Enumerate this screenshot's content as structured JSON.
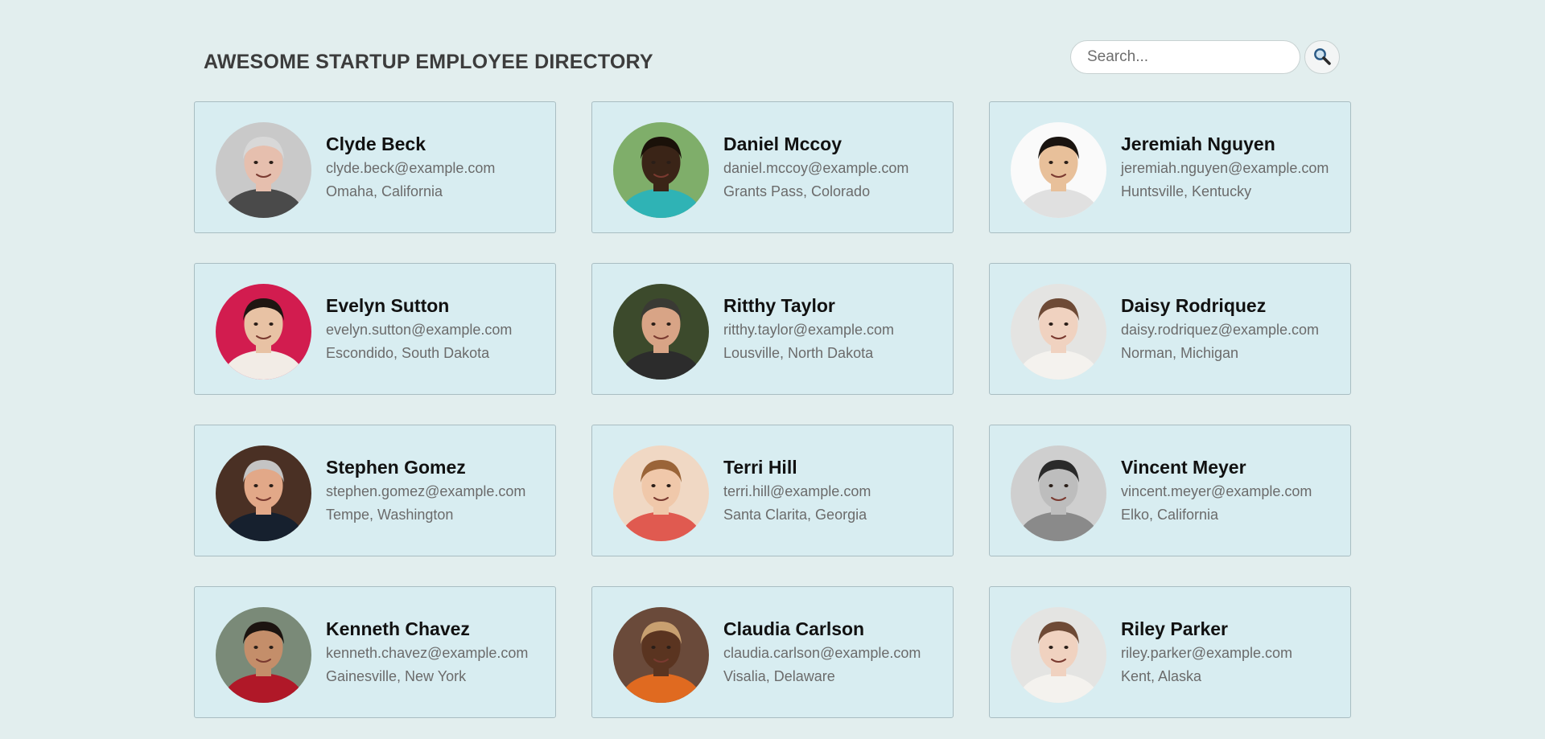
{
  "header": {
    "title": "AWESOME STARTUP EMPLOYEE DIRECTORY",
    "search_placeholder": "Search...",
    "search_value": ""
  },
  "employees": [
    {
      "name": "Clyde Beck",
      "email": "clyde.beck@example.com",
      "location": "Omaha, California",
      "avatar": {
        "bg": "#c9c9c9",
        "skin": "#e6bfae",
        "hair": "#d8d8d8",
        "shirt": "#4a4a4a"
      }
    },
    {
      "name": "Daniel Mccoy",
      "email": "daniel.mccoy@example.com",
      "location": "Grants Pass, Colorado",
      "avatar": {
        "bg": "#7fae6a",
        "skin": "#3a2417",
        "hair": "#1a1109",
        "shirt": "#2fb3b5"
      }
    },
    {
      "name": "Jeremiah Nguyen",
      "email": "jeremiah.nguyen@example.com",
      "location": "Huntsville, Kentucky",
      "avatar": {
        "bg": "#fafafa",
        "skin": "#e8c09a",
        "hair": "#1a1410",
        "shirt": "#e0e0e0"
      }
    },
    {
      "name": "Evelyn Sutton",
      "email": "evelyn.sutton@example.com",
      "location": "Escondido, South Dakota",
      "avatar": {
        "bg": "#d21c4f",
        "skin": "#e8c2a4",
        "hair": "#1f1612",
        "shirt": "#f2ece6"
      }
    },
    {
      "name": "Ritthy Taylor",
      "email": "ritthy.taylor@example.com",
      "location": "Lousville, North Dakota",
      "avatar": {
        "bg": "#3c4a2c",
        "skin": "#d8a486",
        "hair": "#3a3a34",
        "shirt": "#2c2c2c"
      }
    },
    {
      "name": "Daisy Rodriquez",
      "email": "daisy.rodriquez@example.com",
      "location": "Norman, Michigan",
      "avatar": {
        "bg": "#e4e4e2",
        "skin": "#f0d2c0",
        "hair": "#6e4a36",
        "shirt": "#f4f2ee"
      }
    },
    {
      "name": "Stephen Gomez",
      "email": "stephen.gomez@example.com",
      "location": "Tempe, Washington",
      "avatar": {
        "bg": "#4a3024",
        "skin": "#e2a888",
        "hair": "#c4c4c4",
        "shirt": "#16202e"
      }
    },
    {
      "name": "Terri Hill",
      "email": "terri.hill@example.com",
      "location": "Santa Clarita, Georgia",
      "avatar": {
        "bg": "#f0d8c4",
        "skin": "#f0c8aa",
        "hair": "#9a6438",
        "shirt": "#e05a50"
      }
    },
    {
      "name": "Vincent Meyer",
      "email": "vincent.meyer@example.com",
      "location": "Elko, California",
      "avatar": {
        "bg": "#cfcfcf",
        "skin": "#bdbdbd",
        "hair": "#2a2a2a",
        "shirt": "#8a8a8a"
      }
    },
    {
      "name": "Kenneth Chavez",
      "email": "kenneth.chavez@example.com",
      "location": "Gainesville, New York",
      "avatar": {
        "bg": "#7a8a78",
        "skin": "#c48e6a",
        "hair": "#1c1410",
        "shirt": "#b01828"
      }
    },
    {
      "name": "Claudia Carlson",
      "email": "claudia.carlson@example.com",
      "location": "Visalia, Delaware",
      "avatar": {
        "bg": "#6a4a3a",
        "skin": "#5a3420",
        "hair": "#c8a070",
        "shirt": "#e06a20"
      }
    },
    {
      "name": "Riley Parker",
      "email": "riley.parker@example.com",
      "location": "Kent, Alaska",
      "avatar": {
        "bg": "#e4e4e2",
        "skin": "#f0d2c0",
        "hair": "#6e4a36",
        "shirt": "#f4f2ee"
      }
    }
  ]
}
